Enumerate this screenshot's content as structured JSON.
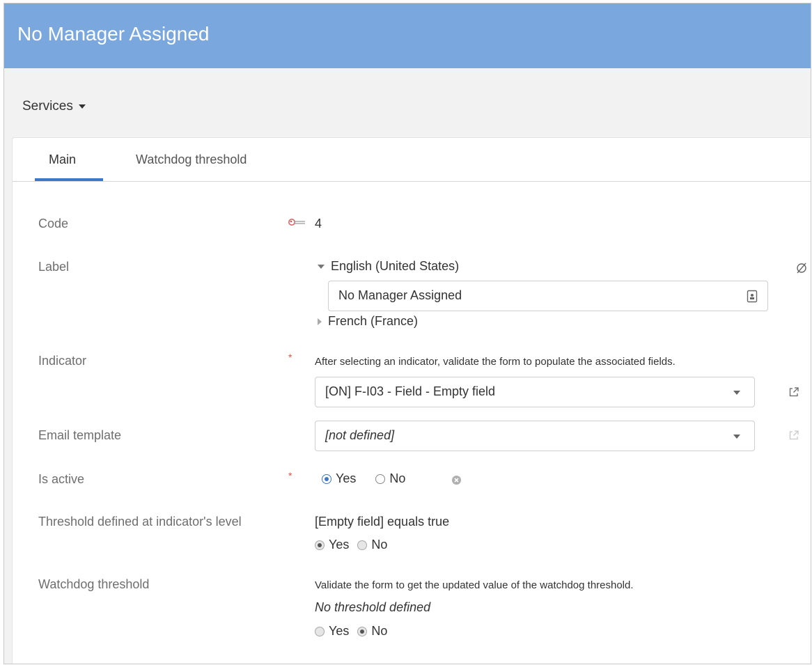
{
  "window": {
    "title": "No Manager Assigned"
  },
  "toolbar": {
    "services_label": "Services"
  },
  "tabs": [
    {
      "label": "Main",
      "active": true
    },
    {
      "label": "Watchdog threshold",
      "active": false
    }
  ],
  "form": {
    "code": {
      "label": "Code",
      "value": "4"
    },
    "label_field": {
      "label": "Label",
      "languages": [
        {
          "name": "English (United States)",
          "expanded": true,
          "value": "No Manager Assigned"
        },
        {
          "name": "French (France)",
          "expanded": false
        }
      ]
    },
    "indicator": {
      "label": "Indicator",
      "required": "*",
      "hint": "After selecting an indicator, validate the form to populate the associated fields.",
      "value": "[ON] F-I03 - Field - Empty field"
    },
    "email_template": {
      "label": "Email template",
      "value": "[not defined]"
    },
    "is_active": {
      "label": "Is active",
      "required": "*",
      "options": [
        "Yes",
        "No"
      ],
      "selected": "Yes"
    },
    "threshold_indicator": {
      "label": "Threshold defined at indicator's level",
      "expression": "[Empty field] equals true",
      "options": [
        "Yes",
        "No"
      ],
      "selected": "Yes"
    },
    "watchdog_threshold": {
      "label": "Watchdog threshold",
      "hint": "Validate the form to get the updated value of the watchdog threshold.",
      "status": "No threshold defined",
      "options": [
        "Yes",
        "No"
      ],
      "selected": "No"
    }
  },
  "icons": {
    "key": "key-icon",
    "null_value": "empty-set-icon",
    "document": "document-icon",
    "external_link": "external-link-icon",
    "clear": "clear-circle-icon"
  },
  "colors": {
    "header": "#7aa7de",
    "accent": "#3c78c8",
    "required": "#d9534f"
  }
}
